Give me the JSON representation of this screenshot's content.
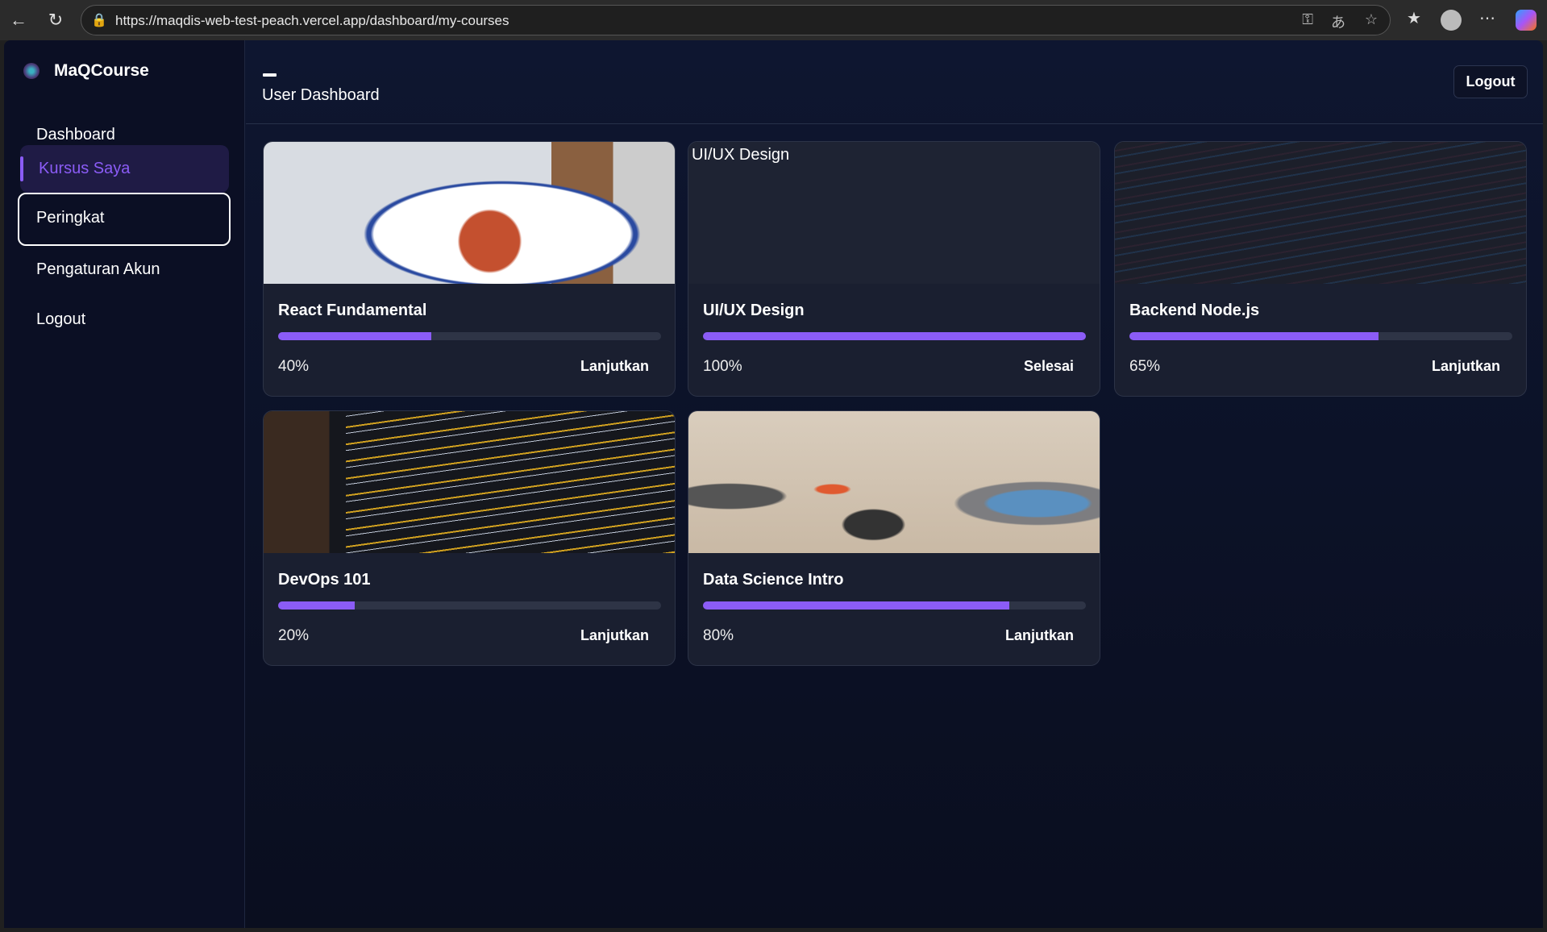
{
  "browser": {
    "url": "https://maqdis-web-test-peach.vercel.app/dashboard/my-courses"
  },
  "sidebar": {
    "brand": "MaQCourse",
    "items": [
      {
        "label": "Dashboard",
        "state": "default"
      },
      {
        "label": "Kursus Saya",
        "state": "active"
      },
      {
        "label": "Peringkat",
        "state": "focused"
      },
      {
        "label": "Pengaturan Akun",
        "state": "default"
      },
      {
        "label": "Logout",
        "state": "default"
      }
    ]
  },
  "header": {
    "title": "User Dashboard",
    "logout_label": "Logout"
  },
  "colors": {
    "accent": "#8b5cf6",
    "card": "#1a1f30",
    "track": "#2e3446"
  },
  "courses": [
    {
      "title": "React Fundamental",
      "progress": 40,
      "progress_label": "40%",
      "action": "Lanjutkan",
      "image": "food-bowl-photo"
    },
    {
      "title": "UI/UX Design",
      "progress": 100,
      "progress_label": "100%",
      "action": "Selesai",
      "image_alt": "UI/UX Design"
    },
    {
      "title": "Backend Node.js",
      "progress": 65,
      "progress_label": "65%",
      "action": "Lanjutkan",
      "image": "code-screen-photo"
    },
    {
      "title": "DevOps 101",
      "progress": 20,
      "progress_label": "20%",
      "action": "Lanjutkan",
      "image": "python-code-photo"
    },
    {
      "title": "Data Science Intro",
      "progress": 80,
      "progress_label": "80%",
      "action": "Lanjutkan",
      "image": "desk-laptops-photo"
    }
  ]
}
